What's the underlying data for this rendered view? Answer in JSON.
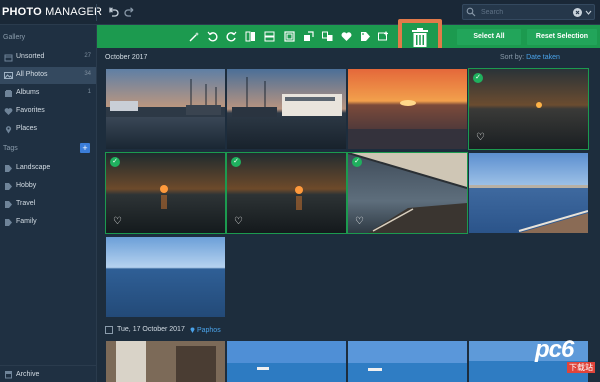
{
  "app": {
    "title_bold": "PHOTO",
    "title_rest": " MANAGER"
  },
  "search": {
    "placeholder": "Search"
  },
  "sidebar": {
    "gallery_heading": "Gallery",
    "gallery_items": [
      {
        "label": "Unsorted",
        "count": "27",
        "icon": "box-icon"
      },
      {
        "label": "All Photos",
        "count": "34",
        "icon": "image-icon"
      },
      {
        "label": "Albums",
        "count": "1",
        "icon": "album-icon"
      },
      {
        "label": "Favorites",
        "count": "",
        "icon": "heart-icon"
      },
      {
        "label": "Places",
        "count": "",
        "icon": "pin-icon"
      }
    ],
    "tags_heading": "Tags",
    "tag_items": [
      {
        "label": "Landscape",
        "icon": "tag-icon"
      },
      {
        "label": "Hobby",
        "icon": "tag-icon"
      },
      {
        "label": "Travel",
        "icon": "tag-icon"
      },
      {
        "label": "Family",
        "icon": "tag-icon"
      }
    ],
    "archive_label": "Archive"
  },
  "actions": {
    "select_all": "Select All",
    "reset_selection": "Reset Selection"
  },
  "content": {
    "date_heading": "October 2017",
    "sort_label": "Sort by:",
    "sort_value": "Date taken",
    "group2_date": "Tue, 17 October 2017",
    "group2_location": "Paphos"
  },
  "colors": {
    "accent_green": "#1c9a4f",
    "highlight_orange": "#e27a4a",
    "link_blue": "#4aa3ea"
  },
  "watermark": {
    "text": "pc6",
    "subtext": "下载站"
  }
}
